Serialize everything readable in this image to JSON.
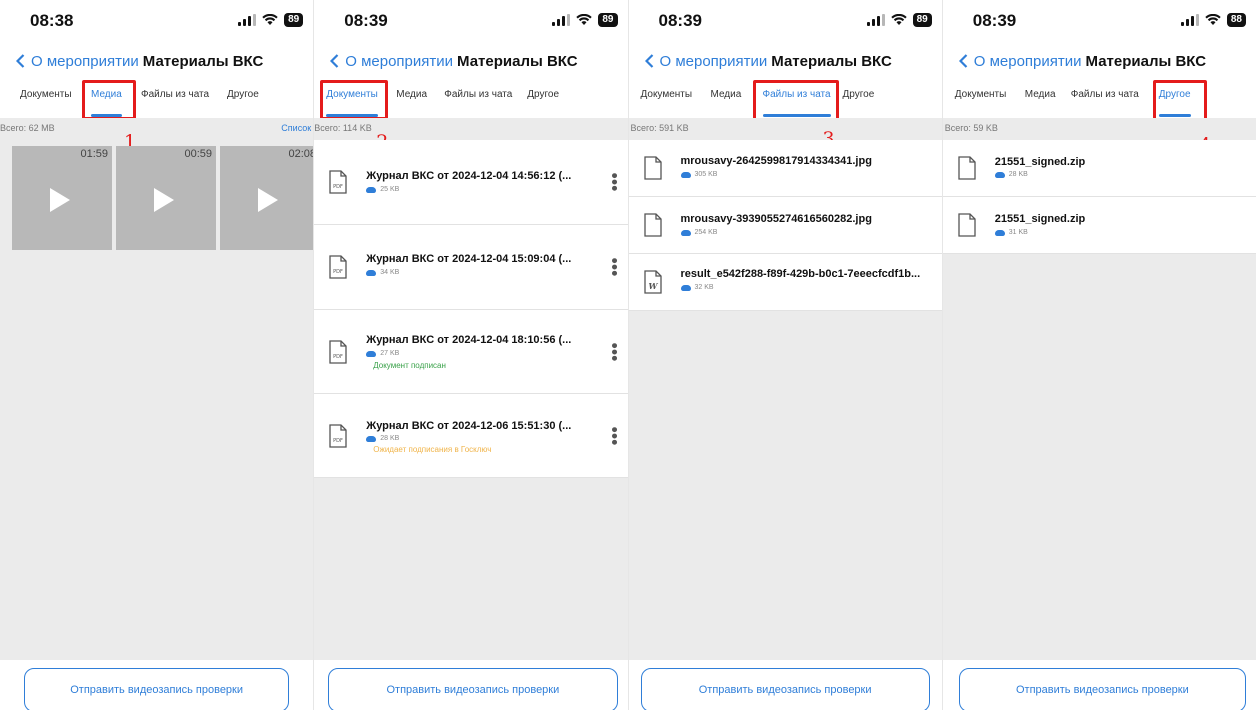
{
  "accent_color": "#2f7ed8",
  "highlight_color": "#e41b1b",
  "screens": [
    {
      "time": "08:38",
      "battery": "89",
      "back_label": "О мероприятии",
      "title": "Материалы ВКС",
      "tabs": [
        "Документы",
        "Медиа",
        "Файлы из чата",
        "Другое"
      ],
      "total": "Всего: 62 MB",
      "list_toggle": "Список",
      "step": "1",
      "videos": [
        {
          "duration": "01:59"
        },
        {
          "duration": "00:59"
        },
        {
          "duration": "02:08"
        }
      ],
      "button": "Отправить видеозапись проверки"
    },
    {
      "time": "08:39",
      "battery": "89",
      "back_label": "О мероприятии",
      "title": "Материалы ВКС",
      "tabs": [
        "Документы",
        "Медиа",
        "Файлы из чата",
        "Другое"
      ],
      "total": "Всего: 114 KB",
      "step": "2",
      "files": [
        {
          "name": "Журнал ВКС от 2024-12-04 14:56:12 (...",
          "size": "25 KB",
          "status": "",
          "icon": "pdf-icon"
        },
        {
          "name": "Журнал ВКС от 2024-12-04 15:09:04 (...",
          "size": "34 KB",
          "status": "",
          "icon": "pdf-icon"
        },
        {
          "name": "Журнал ВКС от 2024-12-04 18:10:56 (...",
          "size": "27 KB",
          "status": "Документ подписан",
          "icon": "pdf-icon"
        },
        {
          "name": "Журнал ВКС от 2024-12-06 15:51:30 (...",
          "size": "28 KB",
          "status": "Ожидает подписания в Госключ",
          "icon": "pdf-icon"
        }
      ],
      "button": "Отправить видеозапись проверки"
    },
    {
      "time": "08:39",
      "battery": "89",
      "back_label": "О мероприятии",
      "title": "Материалы ВКС",
      "tabs": [
        "Документы",
        "Медиа",
        "Файлы из чата",
        "Другое"
      ],
      "total": "Всего: 591 KB",
      "step": "3",
      "files": [
        {
          "name": "mrousavy-2642599817914334341.jpg",
          "size": "305 KB",
          "icon": "file-icon"
        },
        {
          "name": "mrousavy-3939055274616560282.jpg",
          "size": "254 KB",
          "icon": "file-icon"
        },
        {
          "name": "result_e542f288-f89f-429b-b0c1-7eeecfcdf1b...",
          "size": "32 KB",
          "icon": "word-icon"
        }
      ],
      "button": "Отправить видеозапись проверки"
    },
    {
      "time": "08:39",
      "battery": "88",
      "back_label": "О мероприятии",
      "title": "Материалы ВКС",
      "tabs": [
        "Документы",
        "Медиа",
        "Файлы из чата",
        "Другое"
      ],
      "total": "Всего: 59 KB",
      "step": "4",
      "files": [
        {
          "name": "21551_signed.zip",
          "size": "28 KB",
          "icon": "file-icon"
        },
        {
          "name": "21551_signed.zip",
          "size": "31 KB",
          "icon": "file-icon"
        }
      ],
      "button": "Отправить видеозапись проверки"
    }
  ]
}
